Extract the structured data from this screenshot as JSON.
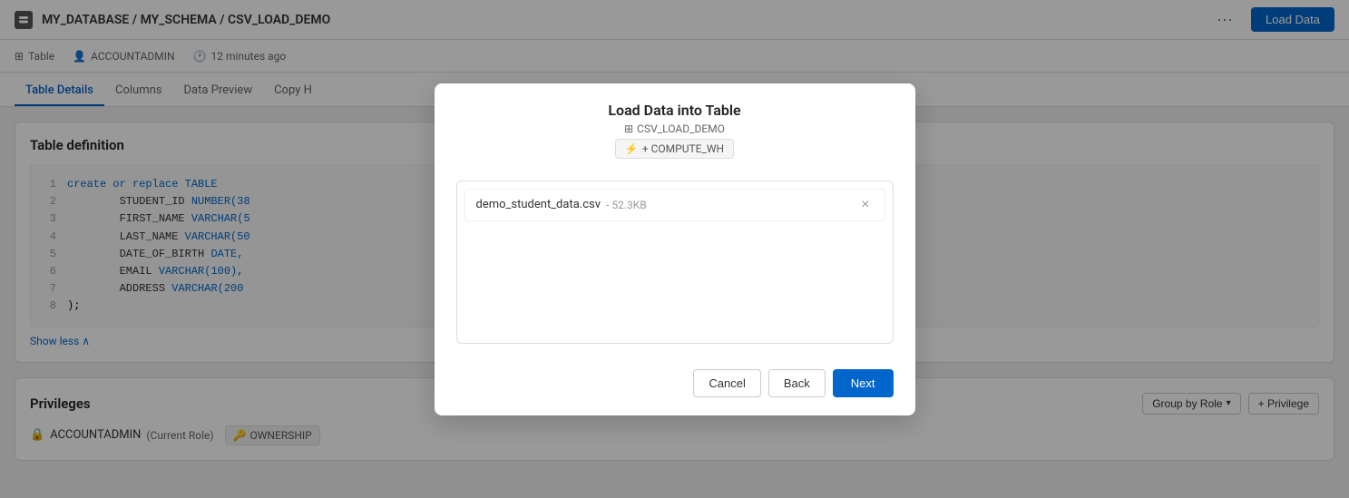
{
  "header": {
    "db_icon": "database-icon",
    "breadcrumb": "MY_DATABASE / MY_SCHEMA / CSV_LOAD_DEMO",
    "more_label": "···",
    "load_data_label": "Load Data"
  },
  "subheader": {
    "table_label": "Table",
    "account_label": "ACCOUNTADMIN",
    "time_label": "12 minutes ago"
  },
  "tabs": [
    {
      "label": "Table Details",
      "active": true
    },
    {
      "label": "Columns",
      "active": false
    },
    {
      "label": "Data Preview",
      "active": false
    },
    {
      "label": "Copy H",
      "active": false
    }
  ],
  "table_definition": {
    "title": "Table definition",
    "code_lines": [
      {
        "num": "1",
        "content": "create or replace TABLE"
      },
      {
        "num": "2",
        "content": "    STUDENT_ID NUMBER(38"
      },
      {
        "num": "3",
        "content": "    FIRST_NAME VARCHAR(5"
      },
      {
        "num": "4",
        "content": "    LAST_NAME VARCHAR(50"
      },
      {
        "num": "5",
        "content": "    DATE_OF_BIRTH DATE,"
      },
      {
        "num": "6",
        "content": "    EMAIL VARCHAR(100),"
      },
      {
        "num": "7",
        "content": "    ADDRESS VARCHAR(200"
      },
      {
        "num": "8",
        "content": ");"
      }
    ],
    "show_less_label": "Show less ∧"
  },
  "privileges": {
    "title": "Privileges",
    "group_by_role_label": "Group by Role",
    "add_privilege_label": "+ Privilege",
    "rows": [
      {
        "role": "ACCOUNTADMIN",
        "current_role": "(Current Role)",
        "privilege": "OWNERSHIP"
      }
    ]
  },
  "modal": {
    "title": "Load Data into Table",
    "subtitle_icon": "table-icon",
    "subtitle": "CSV_LOAD_DEMO",
    "warehouse_label": "+ COMPUTE_WH",
    "file": {
      "name": "demo_student_data.csv",
      "size": "- 52.3KB",
      "remove_label": "×"
    },
    "cancel_label": "Cancel",
    "back_label": "Back",
    "next_label": "Next"
  }
}
